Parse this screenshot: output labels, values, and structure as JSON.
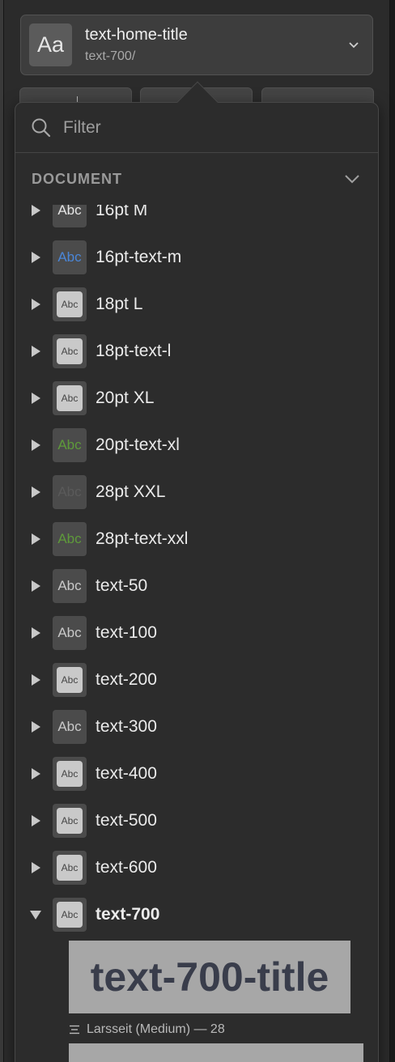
{
  "style_select": {
    "thumb_glyph": "Aa",
    "name": "text-home-title",
    "path": "text-700/",
    "icon": "chevron-down-icon"
  },
  "filter": {
    "placeholder": "Filter",
    "icon": "search-icon"
  },
  "section": {
    "title": "DOCUMENT",
    "icon": "chevron-down-icon"
  },
  "styles": [
    {
      "label": "16pt M",
      "thumb_text": "Abc",
      "thumb_kind": "plain",
      "thumb_color": "#e6e6e6"
    },
    {
      "label": "16pt-text-m",
      "thumb_text": "Abc",
      "thumb_kind": "plain",
      "thumb_color": "#4a86d8"
    },
    {
      "label": "18pt L",
      "thumb_text": "Abc",
      "thumb_kind": "boxed",
      "thumb_color": "#444444"
    },
    {
      "label": "18pt-text-l",
      "thumb_text": "Abc",
      "thumb_kind": "boxed",
      "thumb_color": "#444444"
    },
    {
      "label": "20pt XL",
      "thumb_text": "Abc",
      "thumb_kind": "boxed",
      "thumb_color": "#444444"
    },
    {
      "label": "20pt-text-xl",
      "thumb_text": "Abc",
      "thumb_kind": "plain",
      "thumb_color": "#5e9a3a"
    },
    {
      "label": "28pt XXL",
      "thumb_text": "Abc",
      "thumb_kind": "plain",
      "thumb_color": "#5a5a5a"
    },
    {
      "label": "28pt-text-xxl",
      "thumb_text": "Abc",
      "thumb_kind": "plain",
      "thumb_color": "#5e9a3a"
    },
    {
      "label": "text-50",
      "thumb_text": "Abc",
      "thumb_kind": "plain",
      "thumb_color": "#c9c9c9"
    },
    {
      "label": "text-100",
      "thumb_text": "Abc",
      "thumb_kind": "plain",
      "thumb_color": "#c9c9c9"
    },
    {
      "label": "text-200",
      "thumb_text": "Abc",
      "thumb_kind": "boxed",
      "thumb_color": "#444444"
    },
    {
      "label": "text-300",
      "thumb_text": "Abc",
      "thumb_kind": "plain",
      "thumb_color": "#c9c9c9"
    },
    {
      "label": "text-400",
      "thumb_text": "Abc",
      "thumb_kind": "boxed",
      "thumb_color": "#444444"
    },
    {
      "label": "text-500",
      "thumb_text": "Abc",
      "thumb_kind": "boxed",
      "thumb_color": "#444444"
    },
    {
      "label": "text-600",
      "thumb_text": "Abc",
      "thumb_kind": "boxed",
      "thumb_color": "#444444"
    },
    {
      "label": "text-700",
      "thumb_text": "Abc",
      "thumb_kind": "boxed",
      "thumb_color": "#444444",
      "expanded": true
    }
  ],
  "expanded_child": {
    "preview_text": "text-700-title",
    "meta": "Larsseit (Medium) — 28",
    "meta_icon": "align-left-icon"
  },
  "colors": {
    "background": "#2b2b2b",
    "popover": "#2c2c2c",
    "preview_bg": "#a7a7a7",
    "preview_text": "#393d4b"
  }
}
